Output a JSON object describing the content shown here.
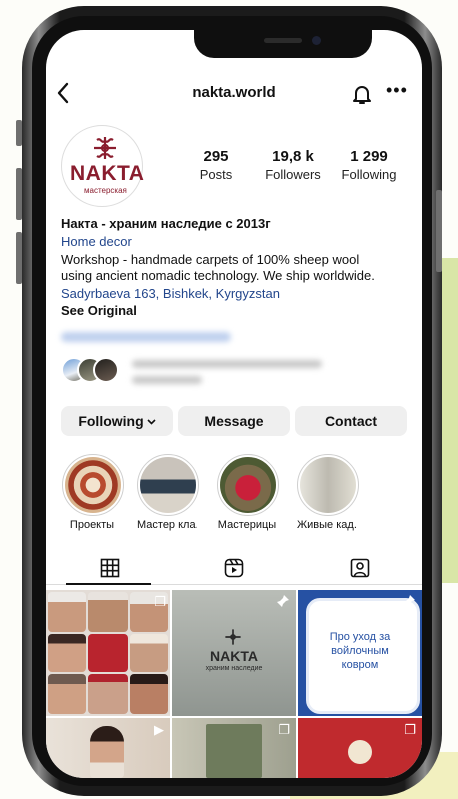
{
  "header": {
    "username": "nakta.world"
  },
  "profile": {
    "logo_text": "NAKTA",
    "logo_sub": "мастерская",
    "stats": [
      {
        "value": "295",
        "label": "Posts"
      },
      {
        "value": "19,8 k",
        "label": "Followers"
      },
      {
        "value": "1 299",
        "label": "Following"
      }
    ],
    "name": "Накта - храним наследие с 2013г",
    "category": "Home decor",
    "bio_line1": "Workshop - handmade carpets of 100% sheep wool",
    "bio_line2": "using ancient nomadic technology. We ship worldwide.",
    "address": "Sadyrbaeva 163, Bishkek, Kyrgyzstan",
    "see_original": "See Original"
  },
  "actions": {
    "following": "Following",
    "message": "Message",
    "contact": "Contact"
  },
  "highlights": [
    {
      "label": "Проекты"
    },
    {
      "label": "Мастер кла..."
    },
    {
      "label": "Мастерицы"
    },
    {
      "label": "Живые кад..."
    }
  ],
  "grid": {
    "post2_brand": "NAKTA",
    "post2_sub": "храним наследие",
    "post3_text_1": "Про уход за",
    "post3_text_2": "войлочным",
    "post3_text_3": "ковром"
  },
  "colors": {
    "link": "#22468c",
    "brand": "#8a1d2e",
    "button_bg": "#efefef"
  },
  "icons": [
    "back-arrow-icon",
    "bell-icon",
    "more-icon",
    "grid-icon",
    "reels-icon",
    "tagged-icon",
    "pin-icon",
    "multi-post-icon",
    "video-icon"
  ]
}
